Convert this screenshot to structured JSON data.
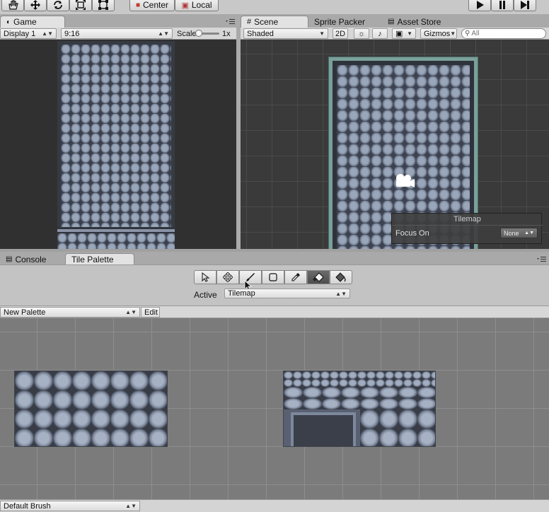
{
  "toolbar": {
    "tools": [
      "hand-icon",
      "move-icon",
      "rotate-icon",
      "scale-icon",
      "rect-tool-icon"
    ],
    "pivot_label": "Center",
    "space_label": "Local",
    "playback": [
      "play-icon",
      "pause-icon",
      "step-icon"
    ]
  },
  "game_panel": {
    "tab_label": "Game",
    "display": "Display 1",
    "aspect": "9:16",
    "scale_label": "Scale",
    "scale_value": "1x"
  },
  "scene_panel": {
    "tabs": [
      {
        "label": "Scene"
      },
      {
        "label": "Sprite Packer"
      },
      {
        "label": "Asset Store"
      }
    ],
    "shading_mode": "Shaded",
    "mode_2d": "2D",
    "gizmos_label": "Gizmos",
    "search_placeholder": "All"
  },
  "tilemap_overlay": {
    "title": "Tilemap",
    "focus_label": "Focus On",
    "focus_value": "None"
  },
  "bottom_tabs": [
    {
      "label": "Console"
    },
    {
      "label": "Tile Palette"
    }
  ],
  "tile_palette": {
    "tools": [
      "select-icon",
      "move-tool-icon",
      "brush-icon",
      "box-fill-icon",
      "picker-icon",
      "eraser-icon",
      "fill-icon"
    ],
    "active_label": "Active",
    "active_target": "Tilemap",
    "palette_name": "New Palette",
    "edit_label": "Edit",
    "brush_name": "Default Brush"
  },
  "colors": {
    "panel_bg": "#c2c2c2",
    "scene_bg": "#3a3a3a",
    "grid_bg": "#7b7b7b",
    "stone": "#8a95a8"
  }
}
